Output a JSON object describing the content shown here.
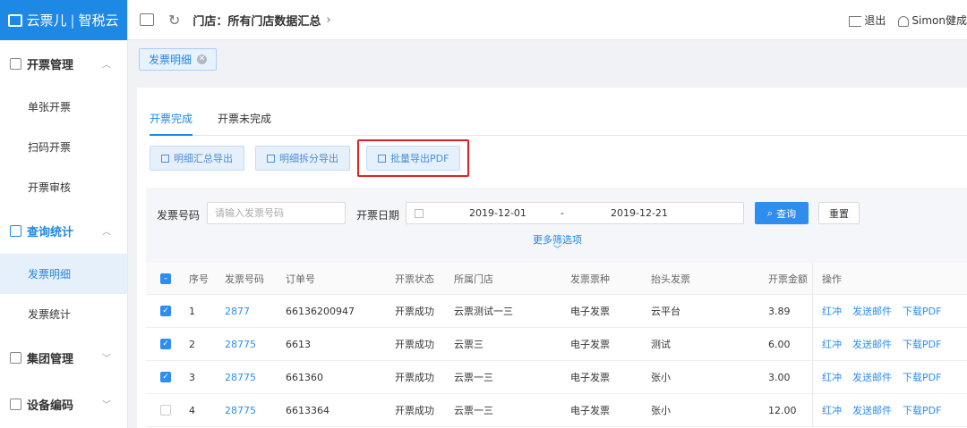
{
  "logo": {
    "brand": "云票儿",
    "product": "智税云"
  },
  "sidebar": {
    "groups": [
      {
        "label": "开票管理",
        "items": [
          "单张开票",
          "扫码开票",
          "开票审核"
        ]
      },
      {
        "label": "查询统计",
        "items": [
          "发票明细",
          "发票统计"
        ]
      },
      {
        "label": "集团管理",
        "items": []
      },
      {
        "label": "设备编码",
        "items": []
      }
    ]
  },
  "topbar": {
    "title": "门店：所有门店数据汇总",
    "logout": "退出",
    "user": "Simon健成"
  },
  "tabstrip": {
    "tag": "发票明细"
  },
  "tabs": [
    "开票完成",
    "开票未完成"
  ],
  "export_buttons": [
    "明细汇总导出",
    "明细拆分导出",
    "批量导出PDF"
  ],
  "filter": {
    "invoice_no_label": "发票号码",
    "invoice_no_placeholder": "请输入发票号码",
    "date_label": "开票日期",
    "date_start": "2019-12-01",
    "date_sep": "-",
    "date_end": "2019-12-21",
    "query": "查询",
    "reset": "重置",
    "more": "更多筛选项"
  },
  "table": {
    "headers": [
      "序号",
      "发票号码",
      "订单号",
      "开票状态",
      "所属门店",
      "发票票种",
      "抬头发票",
      "开票金额",
      "操作"
    ],
    "rows": [
      {
        "no": "1",
        "invoice": "2877",
        "order": "66136200947",
        "status": "开票成功",
        "store": "云票测试一三",
        "kind": "电子发票",
        "title": "云平台",
        "amount": "3.89",
        "checked": true
      },
      {
        "no": "2",
        "invoice": "28775",
        "order": "6613",
        "status": "开票成功",
        "store": "云票三",
        "kind": "电子发票",
        "title": "测试",
        "amount": "6.00",
        "checked": true
      },
      {
        "no": "3",
        "invoice": "28775",
        "order": "661360",
        "status": "开票成功",
        "store": "云票一三",
        "kind": "电子发票",
        "title": "张小",
        "amount": "3.00",
        "checked": true
      },
      {
        "no": "4",
        "invoice": "28775",
        "order": "6613364",
        "status": "开票成功",
        "store": "云票一三",
        "kind": "电子发票",
        "title": "张小",
        "amount": "12.00",
        "checked": false
      }
    ],
    "ops": [
      "红冲",
      "发送邮件",
      "下载PDF"
    ]
  }
}
